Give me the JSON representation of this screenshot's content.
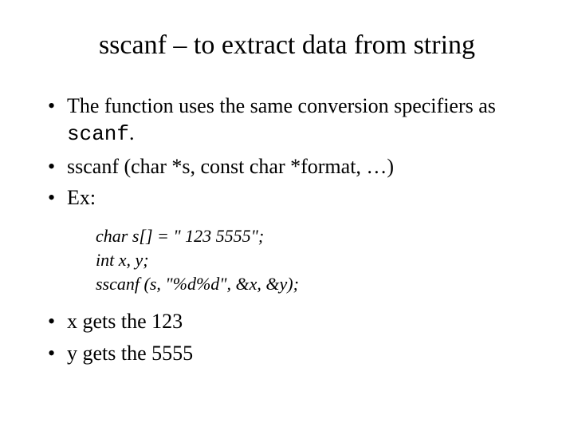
{
  "title": "sscanf – to extract data from string",
  "bullets": {
    "b1_part1": "The function uses the same conversion specifiers as ",
    "b1_code": "scanf",
    "b1_part2": ".",
    "b2": "sscanf (char *s, const char *format, …)",
    "b3": "Ex:",
    "b4": "x gets the 123",
    "b5": "y gets the 5555"
  },
  "code": {
    "l1": "char s[] = \" 123 5555\";",
    "l2": "int x, y;",
    "l3": "sscanf (s, \"%d%d\", &x, &y);"
  }
}
